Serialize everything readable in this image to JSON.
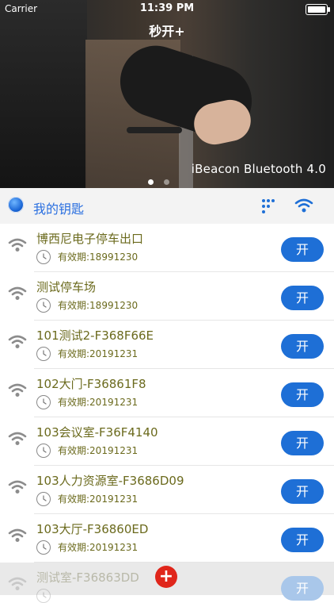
{
  "status": {
    "carrier": "Carrier",
    "time": "11:39 PM"
  },
  "nav": {
    "title": "秒开+"
  },
  "banner": {
    "caption": "iBeacon Bluetooth 4.0"
  },
  "keys_bar": {
    "label": "我的钥匙"
  },
  "rows": [
    {
      "name": "博西尼电子停车出口",
      "valid": "有效期:18991230",
      "button": "开"
    },
    {
      "name": "测试停车场",
      "valid": "有效期:18991230",
      "button": "开"
    },
    {
      "name": "101测试2-F368F66E",
      "valid": "有效期:20191231",
      "button": "开"
    },
    {
      "name": "102大门-F36861F8",
      "valid": "有效期:20191231",
      "button": "开"
    },
    {
      "name": "103会议室-F36F4140",
      "valid": "有效期:20191231",
      "button": "开"
    },
    {
      "name": "103人力资源室-F3686D09",
      "valid": "有效期:20191231",
      "button": "开"
    },
    {
      "name": "103大厅-F36860ED",
      "valid": "有效期:20191231",
      "button": "开"
    },
    {
      "name": "测试室-F36863DD",
      "valid": "",
      "button": "开",
      "disabled": true
    }
  ],
  "add_button": {
    "symbol": "+"
  },
  "colors": {
    "accent": "#1E6FD6",
    "text": "#6B6A1D",
    "add": "#E0261B"
  },
  "icons": [
    "wifi-icon",
    "grid-dots-icon",
    "clock-icon",
    "blue-ball-icon",
    "add-icon"
  ]
}
